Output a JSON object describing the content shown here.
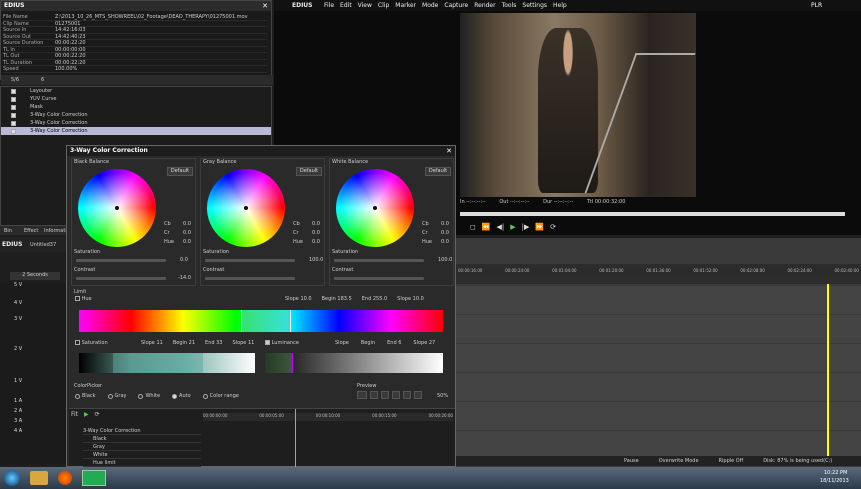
{
  "left_top": {
    "title": "EDIUS",
    "info_rows": [
      {
        "k": "File Name",
        "v": "Z:\\2013_10_26_MTS_SHOWREEL\\02_Footage\\DEAD_THERAPY\\01275001.mov"
      },
      {
        "k": "Clip Name",
        "v": "01275001"
      },
      {
        "k": "Source In",
        "v": "14:42:16:03"
      },
      {
        "k": "Source Out",
        "v": "14:42:40:23"
      },
      {
        "k": "Source Duration",
        "v": "00:00:22:20"
      },
      {
        "k": "TL In",
        "v": "00:00:00:00"
      },
      {
        "k": "TL Out",
        "v": "00:00:22:20"
      },
      {
        "k": "TL Duration",
        "v": "00:00:22:20"
      },
      {
        "k": "Speed",
        "v": "100.00%"
      }
    ],
    "counts": [
      "5/6",
      "6"
    ],
    "effects": [
      "Layouter",
      "YUV Curve",
      "Mask",
      "3-Way Color Correction",
      "3-Way Color Correction",
      "3-Way Color Correction"
    ],
    "tabs": [
      "Bin",
      "Effect",
      "Information"
    ]
  },
  "menu": {
    "title": "EDIUS",
    "items": [
      "File",
      "Edit",
      "View",
      "Clip",
      "Marker",
      "Mode",
      "Capture",
      "Render",
      "Tools",
      "Settings",
      "Help"
    ],
    "plr": "PLR"
  },
  "player": {
    "in_label": "In",
    "in_val": "--:--:--:--",
    "out_label": "Out",
    "out_val": "--:--:--:--",
    "dur_label": "Dur",
    "dur_val": "--:--:--:--",
    "ttl_label": "Ttl",
    "ttl_val": "00:00:32:00"
  },
  "cc": {
    "title": "3-Way Color Correction",
    "default": "Default",
    "sections": [
      {
        "name": "Black Balance",
        "cb": "0.0",
        "cr": "0.0",
        "hue": "0.0",
        "sat_label": "Saturation",
        "sat": "0.0",
        "con_label": "Contrast",
        "con": "-14.0"
      },
      {
        "name": "Gray Balance",
        "cb": "0.0",
        "cr": "0.0",
        "hue": "0.0",
        "sat_label": "Saturation",
        "sat": "100.0",
        "con_label": "Contrast",
        "con": ""
      },
      {
        "name": "White Balance",
        "cb": "0.0",
        "cr": "0.0",
        "hue": "0.0",
        "sat_label": "Saturation",
        "sat": "100.0",
        "con_label": "Contrast",
        "con": ""
      }
    ],
    "cb_label": "Cb",
    "cr_label": "Cr",
    "hue_label": "Hue",
    "limit": "Limit",
    "hue": "Hue",
    "hue_params": [
      "Slope 10.0",
      "Begin 183.5",
      "End 255.0",
      "Slope 10.0"
    ],
    "saturation": "Saturation",
    "sat_params": [
      "Slope 11",
      "Begin 21",
      "End 33",
      "Slope 11"
    ],
    "luminance": "Luminance",
    "lum_params": [
      "Slope",
      "Begin",
      "End 6",
      "Slope 27"
    ],
    "colorpicker": "ColorPicker",
    "radios": [
      "Black",
      "Gray",
      "White",
      "Auto",
      "Color range"
    ],
    "preview": "Preview",
    "zoom": "50%"
  },
  "timeline_left": {
    "title": "EDIUS",
    "project": "Untitled37",
    "scale": "2 Seconds",
    "tracks": [
      "5 V",
      "4 V",
      "3 V",
      "2 V",
      "1 V",
      "1 A",
      "2 A",
      "3 A",
      "4 A"
    ]
  },
  "keyframe": {
    "rows": [
      "3-Way Color Correction",
      "Black",
      "Gray",
      "White",
      "Hue limit"
    ],
    "ruler": [
      "00:00:00:00",
      "00:00:05:00",
      "00:00:10:00",
      "00:00:15:00",
      "00:00:20:00"
    ],
    "label": "Fit"
  },
  "timeline_right": {
    "ruler": [
      "00:00:16:00",
      "00:00:24:00",
      "00:01:04:00",
      "00:01:20:00",
      "00:01:36:00",
      "00:01:52:00",
      "00:02:08:00",
      "00:02:24:00",
      "00:02:40:00"
    ],
    "status": [
      "Pause",
      "Overwrite Mode",
      "Ripple Off",
      "Disk: 87% is being used(C:)"
    ]
  },
  "taskbar": {
    "time": "10:22 PM",
    "date": "18/11/2013"
  }
}
